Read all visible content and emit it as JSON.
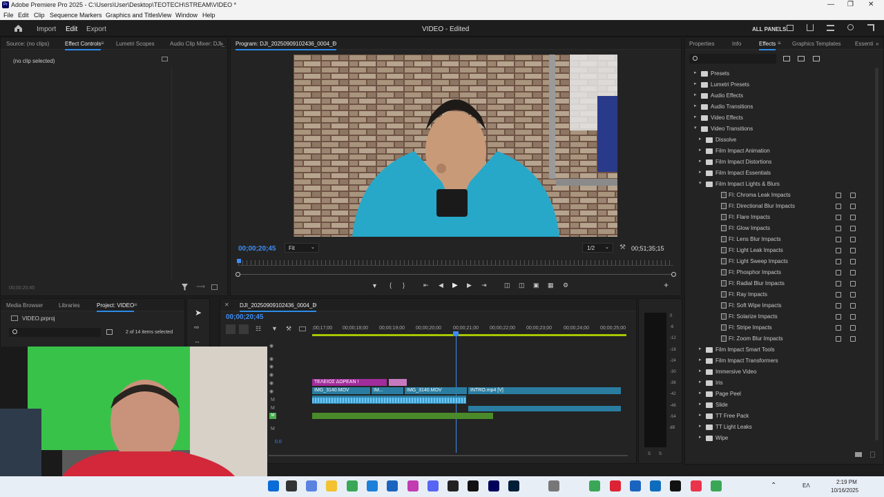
{
  "window": {
    "title": "Adobe Premiere Pro 2025 - C:\\Users\\User\\Desktop\\TEOTECH\\STREAM\\VIDEO *"
  },
  "menu": [
    "File",
    "Edit",
    "Clip",
    "Sequence",
    "Markers",
    "Graphics and Titles",
    "View",
    "Window",
    "Help"
  ],
  "workspace": {
    "import": "Import",
    "edit": "Edit",
    "export": "Export",
    "project_title": "VIDEO - Edited",
    "all_panels": "ALL PANELS"
  },
  "effect_controls": {
    "tabs": [
      "Source: (no clips)",
      "Effect Controls",
      "Lumetri Scopes",
      "Audio Clip Mixer: DJI_"
    ],
    "no_clip": "(no clip selected)",
    "timecode": "00;00;20;45"
  },
  "program": {
    "tab": "Program: DJI_20250909102436_0004_D",
    "timecode": "00;00;20;45",
    "fit": "Fit",
    "resolution": "1/2",
    "duration": "00;51;35;15"
  },
  "effects": {
    "tabs": [
      "Properties",
      "Info",
      "Effects",
      "Graphics Templates",
      "Essenti"
    ],
    "folders": [
      "Presets",
      "Lumetri Presets",
      "Audio Effects",
      "Audio Transitions",
      "Video Effects",
      "Video Transitions"
    ],
    "transition_folders_a": [
      "Dissolve",
      "Film Impact Animation",
      "Film Impact Distortions",
      "Film Impact Essentials",
      "Film Impact Lights & Blurs"
    ],
    "items": [
      "FI: Chroma Leak Impacts",
      "FI: Directional Blur Impacts",
      "FI: Flare Impacts",
      "FI: Glow Impacts",
      "FI: Lens Blur Impacts",
      "FI: Light Leak Impacts",
      "FI: Light Sweep Impacts",
      "FI: Phosphor Impacts",
      "FI: Radial Blur Impacts",
      "FI: Ray Impacts",
      "FI: Soft Wipe Impacts",
      "FI: Solarize Impacts",
      "FI: Stripe Impacts",
      "FI: Zoom Blur Impacts"
    ],
    "transition_folders_b": [
      "Film Impact Smart Tools",
      "Film Impact Transformers",
      "Immersive Video",
      "Iris",
      "Page Peel",
      "Slide",
      "TT Free Pack",
      "TT Light Leaks",
      "Wipe"
    ]
  },
  "project": {
    "tabs": [
      "Media Browser",
      "Libraries",
      "Project: VIDEO"
    ],
    "file": "VIDEO.prproj",
    "selected": "2 of 14 items selected"
  },
  "timeline": {
    "tab": "DJI_20250909102436_0004_D",
    "timecode": "00;00;20;45",
    "ruler": [
      ";00;17;00",
      "00;00;18;00",
      "00;00;19;00",
      "00;00;20;00",
      "00;00;21;00",
      "00;00;22;00",
      "00;00;23;00",
      "00;00;24;00",
      "00;00;25;00"
    ],
    "clips": {
      "title": "ΤΕΛΕΙΟΣ ΔΩΡΕΑΝ !",
      "v1a": "IMG_3140.MOV",
      "v1b": "IM...",
      "v1c": "IMG_3140.MOV",
      "intro": "INTRO.mp4 [V]"
    },
    "vol": "0.0"
  },
  "meters": [
    "0",
    "-6",
    "-12",
    "-18",
    "-24",
    "-30",
    "-36",
    "-42",
    "-48",
    "-54",
    "dB"
  ],
  "meter_ss": [
    "S",
    "S"
  ],
  "taskbar": {
    "lang": "ΕΛ",
    "time": "2:19 PM",
    "date": "10/16/2025"
  }
}
